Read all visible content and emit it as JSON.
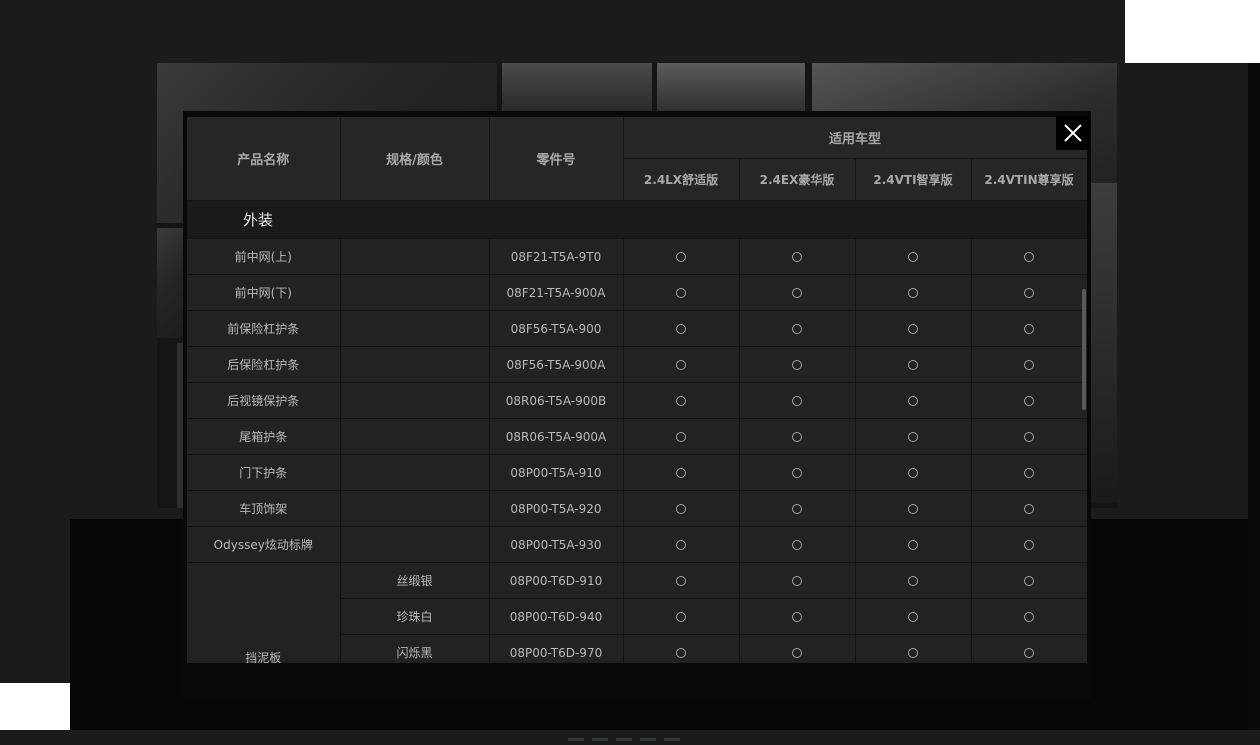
{
  "header": {
    "product_name": "产品名称",
    "spec_color": "规格/颜色",
    "part_number": "零件号",
    "applicable_models": "适用车型",
    "models": [
      "2.4LX舒适版",
      "2.4EX豪华版",
      "2.4VTI智享版",
      "2.4VTIN尊享版"
    ]
  },
  "section": {
    "title": "外装"
  },
  "rows": [
    {
      "name": "前中网(上)",
      "spec": "",
      "part": "08F21-T5A-9T0"
    },
    {
      "name": "前中网(下)",
      "spec": "",
      "part": "08F21-T5A-900A"
    },
    {
      "name": "前保险杠护条",
      "spec": "",
      "part": "08F56-T5A-900"
    },
    {
      "name": "后保险杠护条",
      "spec": "",
      "part": "08F56-T5A-900A"
    },
    {
      "name": "后视镜保护条",
      "spec": "",
      "part": "08R06-T5A-900B"
    },
    {
      "name": "尾箱护条",
      "spec": "",
      "part": "08R06-T5A-900A"
    },
    {
      "name": "门下护条",
      "spec": "",
      "part": "08P00-T5A-910"
    },
    {
      "name": "车顶饰架",
      "spec": "",
      "part": "08P00-T5A-920"
    },
    {
      "name": "Odyssey炫动标牌",
      "spec": "",
      "part": "08P00-T5A-930"
    }
  ],
  "mudguard": {
    "name": "挡泥板",
    "variants": [
      {
        "spec": "丝缎银",
        "part": "08P00-T6D-910"
      },
      {
        "spec": "珍珠白",
        "part": "08P00-T6D-940"
      },
      {
        "spec": "闪烁黑",
        "part": "08P00-T6D-970"
      }
    ]
  },
  "availability_symbol": "circle",
  "icons": {
    "close": "close-icon"
  },
  "colors": {
    "background": "#1b1b1b",
    "table": "#222222",
    "header": "#262626",
    "accent": "#ffffff"
  }
}
